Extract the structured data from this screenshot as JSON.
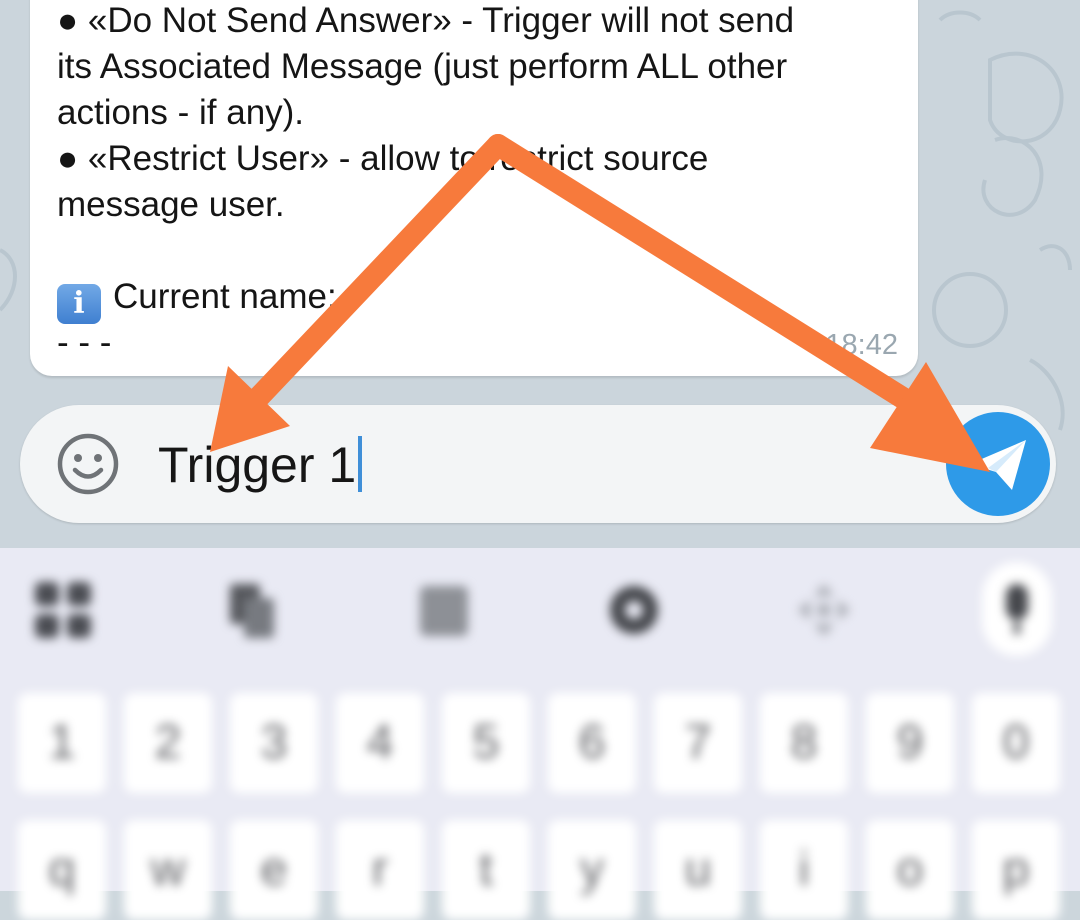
{
  "message": {
    "lines": [
      "● «Do Not Send Answer» - Trigger will not send",
      "its Associated Message (just perform ALL other",
      "actions - if any).",
      "● «Restrict User» - allow to restrict source",
      "message user."
    ],
    "info_badge": "i",
    "current_name_label": "Current name:",
    "separator": "- - -",
    "time": "18:42"
  },
  "input": {
    "value": "Trigger 1",
    "emoji_icon": "smiley-icon",
    "send_icon": "send-paper-plane-icon"
  },
  "annotations": {
    "arrow_color": "#f77a3c"
  },
  "keyboard": {
    "toolbar_icons": [
      "apps-grid-icon",
      "clipboard-icon",
      "keyboard-layout-icon",
      "settings-gear-icon",
      "cursor-move-icon",
      "microphone-icon"
    ],
    "number_row": [
      "1",
      "2",
      "3",
      "4",
      "5",
      "6",
      "7",
      "8",
      "9",
      "0"
    ],
    "letter_row": [
      "q",
      "w",
      "e",
      "r",
      "t",
      "y",
      "u",
      "i",
      "o",
      "p"
    ],
    "letter_row_hints": [
      "%",
      "\\",
      "|",
      "=",
      "[",
      "]",
      "<",
      ">",
      "{",
      "}"
    ]
  },
  "colors": {
    "send_button": "#2e9ae8",
    "chat_background": "#cbd5dc",
    "keyboard_background": "#e9eaf4"
  }
}
